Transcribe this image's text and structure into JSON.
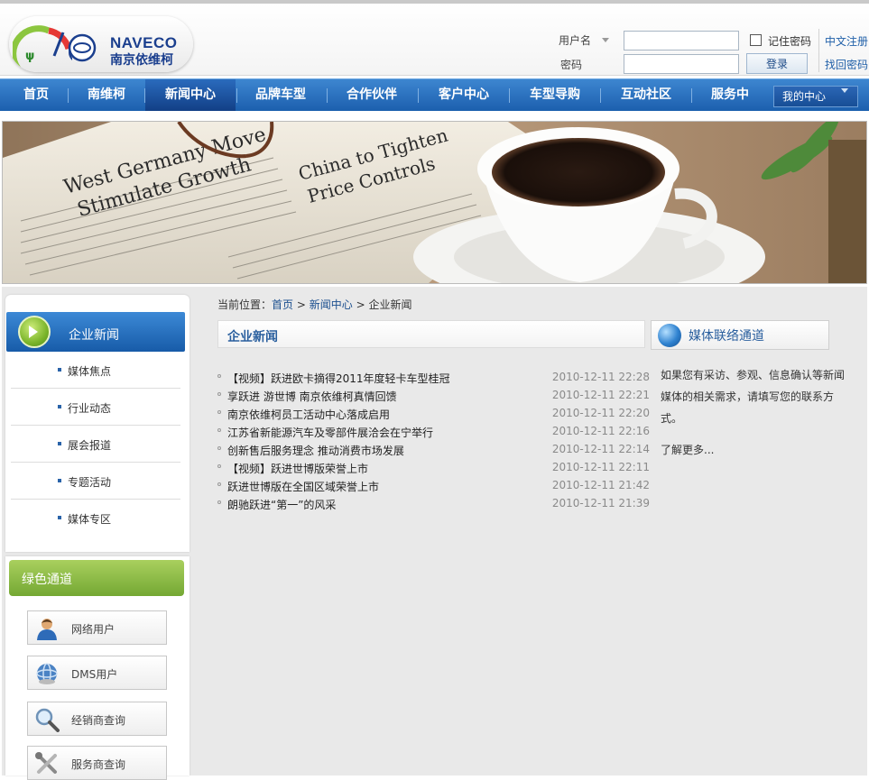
{
  "brand": {
    "name_en": "NAVECO",
    "name_cn": "南京依维柯",
    "colors": {
      "primary_blue": "#1c5fae",
      "nav_active": "#123f86",
      "green_channel": "#74a833",
      "link": "#1f5fa8"
    }
  },
  "login": {
    "username_label": "用户名",
    "password_label": "密码",
    "username_value": "",
    "password_value": "",
    "remember_label": "记住密码",
    "login_button": "登录",
    "register_link": "中文注册",
    "recover_link": "找回密码"
  },
  "nav": {
    "items": [
      {
        "label": "首页",
        "active": false
      },
      {
        "label": "南维柯",
        "active": false
      },
      {
        "label": "新闻中心",
        "active": true
      },
      {
        "label": "品牌车型",
        "active": false
      },
      {
        "label": "合作伙伴",
        "active": false
      },
      {
        "label": "客户中心",
        "active": false
      },
      {
        "label": "车型导购",
        "active": false
      },
      {
        "label": "互动社区",
        "active": false
      },
      {
        "label": "服务中",
        "active": false
      }
    ],
    "my_center": "我的中心"
  },
  "sidebar": {
    "section_title": "企业新闻",
    "items": [
      "媒体焦点",
      "行业动态",
      "展会报道",
      "专题活动",
      "媒体专区"
    ],
    "green_title": "绿色通道",
    "channels": [
      {
        "label": "网络用户",
        "icon": "user-icon"
      },
      {
        "label": "DMS用户",
        "icon": "globe-icon"
      },
      {
        "label": "经销商查询",
        "icon": "magnifier-icon"
      },
      {
        "label": "服务商查询",
        "icon": "wrench-icon"
      }
    ]
  },
  "breadcrumb": {
    "prefix": "当前位置：",
    "home": "首页",
    "sep": ">",
    "section": "新闻中心",
    "current": "企业新闻"
  },
  "news": {
    "title": "企业新闻",
    "items": [
      {
        "title": "【视频】跃进欧卡摘得2011年度轻卡车型桂冠",
        "date": "2010-12-11 22:28"
      },
      {
        "title": "享跃进 游世博 南京依维柯真情回馈",
        "date": "2010-12-11 22:21"
      },
      {
        "title": "南京依维柯员工活动中心落成启用",
        "date": "2010-12-11 22:20"
      },
      {
        "title": "江苏省新能源汽车及零部件展洽会在宁举行",
        "date": "2010-12-11 22:16"
      },
      {
        "title": "创新售后服务理念 推动消费市场发展",
        "date": "2010-12-11 22:14"
      },
      {
        "title": "【视频】跃进世博版荣誉上市",
        "date": "2010-12-11 22:11"
      },
      {
        "title": "跃进世博版在全国区域荣誉上市",
        "date": "2010-12-11 21:42"
      },
      {
        "title": "朗驰跃进“第一”的风采",
        "date": "2010-12-11 21:39"
      }
    ]
  },
  "media": {
    "title": "媒体联络通道",
    "text": "如果您有采访、参观、信息确认等新闻媒体的相关需求，请填写您的联系方式。",
    "more": "了解更多..."
  },
  "banner": {
    "headline_1": "West Germany Move",
    "headline_2": "Stimulate Growth",
    "headline_3": "China to Tighten",
    "headline_4": "Price Controls"
  }
}
